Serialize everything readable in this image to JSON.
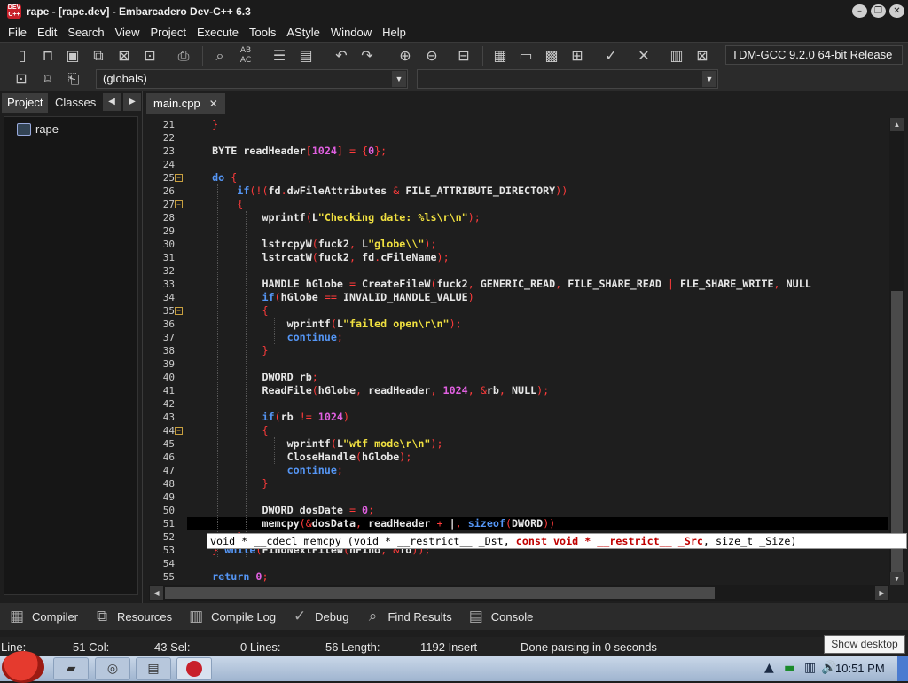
{
  "window": {
    "title": "rape - [rape.dev] - Embarcadero Dev-C++ 6.3",
    "app_icon": "DEV C++"
  },
  "menu": [
    "File",
    "Edit",
    "Search",
    "View",
    "Project",
    "Execute",
    "Tools",
    "AStyle",
    "Window",
    "Help"
  ],
  "toolbar": {
    "compiler": "TDM-GCC 9.2.0 64-bit Release",
    "globals": "(globals)"
  },
  "left_panel": {
    "tabs": [
      "Project",
      "Classes"
    ],
    "tree_root": "rape"
  },
  "editor": {
    "tab": "main.cpp",
    "lines": [
      "21",
      "22",
      "23",
      "24",
      "25",
      "26",
      "27",
      "28",
      "29",
      "30",
      "31",
      "32",
      "33",
      "34",
      "35",
      "36",
      "37",
      "38",
      "39",
      "40",
      "41",
      "42",
      "43",
      "44",
      "45",
      "46",
      "47",
      "48",
      "49",
      "50",
      "51",
      "52",
      "53",
      "54",
      "55"
    ],
    "hint": {
      "p1": "void * __cdecl memcpy (void * __restrict__ _Dst, ",
      "p2": "const void * __restrict__ _Src",
      "p3": ", size_t _Size)"
    }
  },
  "bottom_tabs": [
    "Compiler",
    "Resources",
    "Compile Log",
    "Debug",
    "Find Results",
    "Console"
  ],
  "status": {
    "line": "Line:",
    "line_val": "51 Col:",
    "col_val": "43 Sel:",
    "sel_val": "0 Lines:",
    "lines_val": "56 Length:",
    "length_val": "1192 Insert",
    "msg": "Done parsing in 0 seconds"
  },
  "tooltip": "Show desktop",
  "taskbar": {
    "time": "10:51 PM"
  }
}
